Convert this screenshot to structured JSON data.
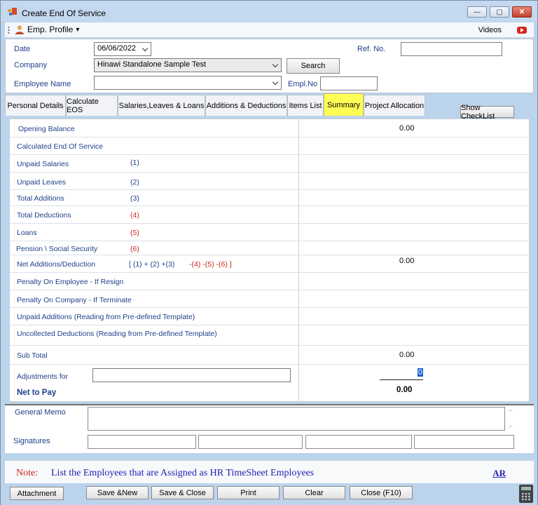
{
  "window": {
    "title": "Create End Of Service",
    "min": "—",
    "max": "▢",
    "close": "✕"
  },
  "menu": {
    "emp_profile": "Emp. Profile",
    "arrow": "▾",
    "videos": "Videos"
  },
  "header": {
    "date_label": "Date",
    "date_value": "06/06/2022",
    "ref_label": "Ref. No.",
    "ref_value": "",
    "company_label": "Company",
    "company_value": "Hinawi Standalone Sample Test",
    "search_label": "Search",
    "employee_label": "Employee Name",
    "employee_value": "",
    "emplno_label": "Empl.No",
    "emplno_value": ""
  },
  "tabs": [
    {
      "label": "Personal Details"
    },
    {
      "label": "Calculate EOS"
    },
    {
      "label": "Salaries,Leaves & Loans"
    },
    {
      "label": "Additions & Deductions"
    },
    {
      "label": "Items List"
    },
    {
      "label": "Summary"
    },
    {
      "label": "Project Allocation"
    }
  ],
  "show_checklist": "Show CheckList",
  "summary": {
    "opening_balance": "Opening Balance",
    "opening_balance_value": "0.00",
    "calculated_eos": "Calculated End Of Service",
    "unpaid_salaries": "Unpaid Salaries",
    "unpaid_salaries_num": "(1)",
    "unpaid_leaves": "Unpaid Leaves",
    "unpaid_leaves_num": "(2)",
    "total_additions": "Total Additions",
    "total_additions_num": "(3)",
    "total_deductions": "Total Deductions",
    "total_deductions_num": "(4)",
    "loans": "Loans",
    "loans_num": "(5)",
    "pension": "Pension \\ Social Security",
    "pension_num": "(6)",
    "net_add_ded": "Net Additions/Deduction",
    "formula_blue": "[ (1) + (2) +(3)",
    "formula_red": "-(4) -(5) -(6) ]",
    "net_add_ded_value": "0.00",
    "penalty_employee": "Penalty On Employee - If Resign",
    "penalty_company": "Penalty On Company - If Terminate",
    "unpaid_additions_tpl": "Unpaid Additions (Reading from Pre-defined Template)",
    "uncollected_ded_tpl": "Uncollected Deductions (Reading from Pre-defined Template)",
    "sub_total": "Sub Total",
    "sub_total_value": "0.00",
    "adjustments_for": "Adjustments for",
    "adjustments_input": "",
    "adjustments_value": "0",
    "net_to_pay": "Net to Pay",
    "net_to_pay_value": "0.00"
  },
  "lower": {
    "general_memo": "General Memo",
    "signatures": "Signatures",
    "scroll_up": "⌃",
    "scroll_down": "⌄"
  },
  "note": {
    "label": "Note:",
    "text": "List the Employees that are Assigned as HR  TimeSheet Employees",
    "ar": "AR"
  },
  "footer": {
    "attachment": "Attachment",
    "save_new": "Save &New",
    "save_close": "Save & Close",
    "print": "Print",
    "clear": "Clear",
    "close": "Close (F10)"
  },
  "colors": {
    "accent_blue": "#1f3f8a",
    "red": "#c8271c",
    "active_tab": "#ffff55",
    "note_blue": "#2320b5"
  }
}
